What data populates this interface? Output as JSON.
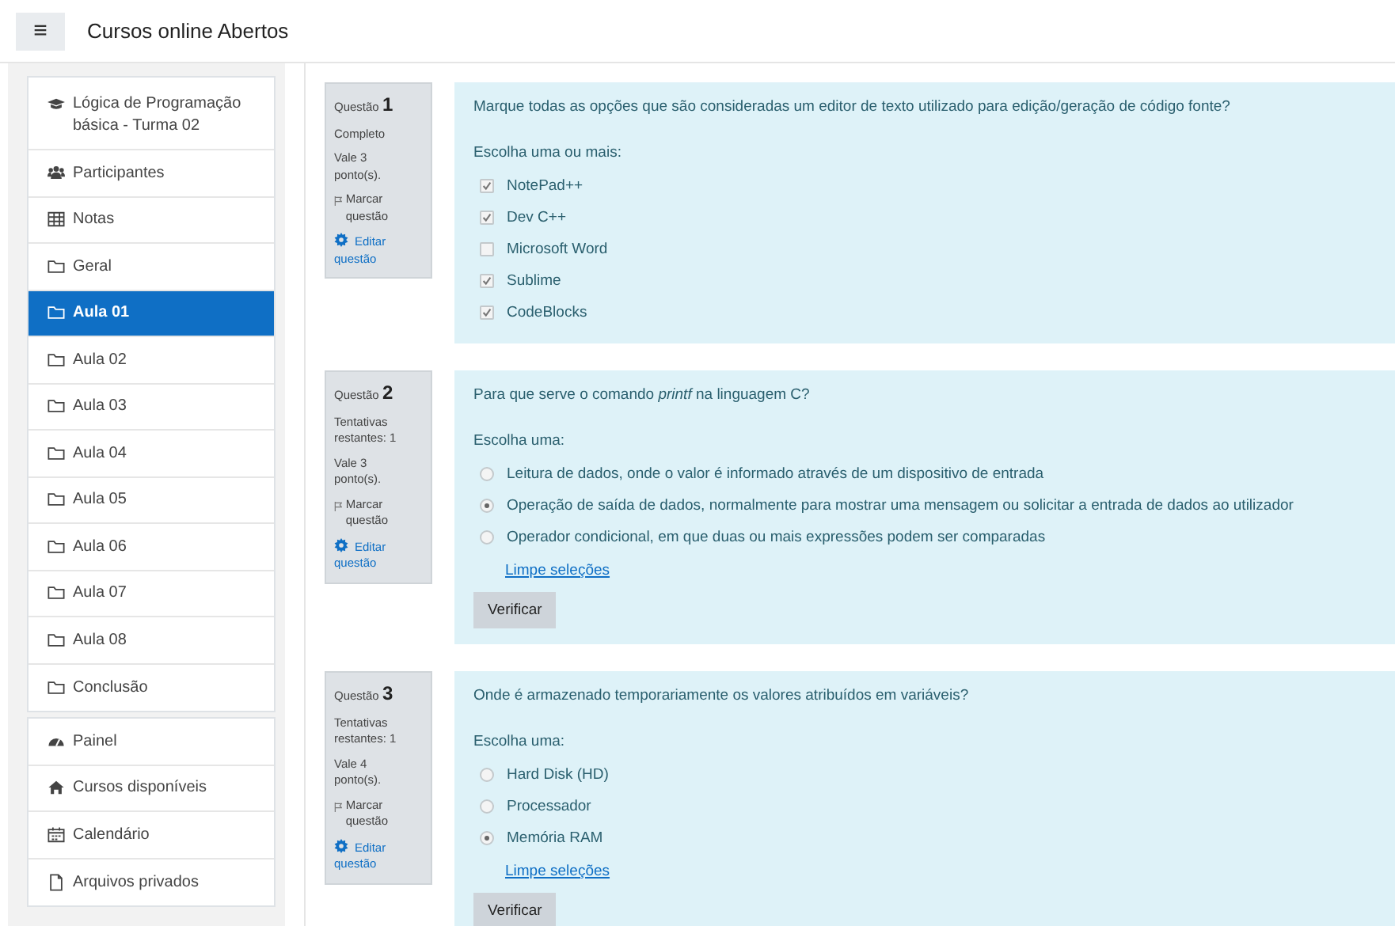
{
  "header": {
    "menu_icon": "≡",
    "title": "Cursos online Abertos"
  },
  "sidebar": {
    "groups": [
      [
        {
          "kind": "cap",
          "label": "Lógica de Programação básica - Turma 02",
          "selected": false
        },
        {
          "kind": "users",
          "label": "Participantes",
          "selected": false
        },
        {
          "kind": "table",
          "label": "Notas",
          "selected": false
        },
        {
          "kind": "folder",
          "label": "Geral",
          "selected": false
        },
        {
          "kind": "folder",
          "label": "Aula 01",
          "selected": true
        },
        {
          "kind": "folder",
          "label": "Aula 02",
          "selected": false
        },
        {
          "kind": "folder",
          "label": "Aula 03",
          "selected": false
        },
        {
          "kind": "folder",
          "label": "Aula 04",
          "selected": false
        },
        {
          "kind": "folder",
          "label": "Aula 05",
          "selected": false
        },
        {
          "kind": "folder",
          "label": "Aula 06",
          "selected": false
        },
        {
          "kind": "folder",
          "label": "Aula 07",
          "selected": false
        },
        {
          "kind": "folder",
          "label": "Aula 08",
          "selected": false
        },
        {
          "kind": "folder",
          "label": "Conclusão",
          "selected": false
        }
      ],
      [
        {
          "kind": "dashboard",
          "label": "Painel",
          "selected": false
        },
        {
          "kind": "home",
          "label": "Cursos disponíveis",
          "selected": false
        },
        {
          "kind": "calendar",
          "label": "Calendário",
          "selected": false
        },
        {
          "kind": "file",
          "label": "Arquivos privados",
          "selected": false
        }
      ]
    ]
  },
  "questions": [
    {
      "label": "Questão",
      "number": "1",
      "status": "Completo",
      "points": "Vale 3 ponto(s).",
      "flag": "Marcar questão",
      "edit": "Editar questão",
      "text": "Marque todas as opções que são consideradas um editor de texto utilizado para edição/geração de código fonte?",
      "prompt": "Escolha uma ou mais:",
      "kind": "checkbox",
      "options": [
        {
          "label": "NotePad++",
          "checked": true
        },
        {
          "label": "Dev C++",
          "checked": true
        },
        {
          "label": "Microsoft Word",
          "checked": false
        },
        {
          "label": "Sublime",
          "checked": true
        },
        {
          "label": "CodeBlocks",
          "checked": true
        }
      ]
    },
    {
      "label": "Questão",
      "number": "2",
      "status": "Tentativas restantes: 1",
      "points": "Vale 3 ponto(s).",
      "flag": "Marcar questão",
      "edit": "Editar questão",
      "text": "Para que serve o comando *printf* na linguagem C?",
      "prompt": "Escolha uma:",
      "kind": "radio",
      "options": [
        {
          "label": "Leitura de dados, onde o valor é informado através de um dispositivo de entrada",
          "checked": false
        },
        {
          "label": "Operação de saída de dados, normalmente para mostrar uma mensagem ou solicitar a entrada de dados ao utilizador",
          "checked": true
        },
        {
          "label": "Operador condicional, em que duas ou mais expressões podem ser comparadas",
          "checked": false
        }
      ],
      "clear": "Limpe seleções",
      "button": "Verificar"
    },
    {
      "label": "Questão",
      "number": "3",
      "status": "Tentativas restantes: 1",
      "points": "Vale 4 ponto(s).",
      "flag": "Marcar questão",
      "edit": "Editar questão",
      "text": "Onde é armazenado temporariamente os valores atribuídos em variáveis?",
      "prompt": "Escolha uma:",
      "kind": "radio",
      "options": [
        {
          "label": "Hard Disk (HD)",
          "checked": false
        },
        {
          "label": "Processador",
          "checked": false
        },
        {
          "label": "Memória RAM",
          "checked": true
        }
      ],
      "clear": "Limpe seleções",
      "button": "Verificar"
    }
  ]
}
